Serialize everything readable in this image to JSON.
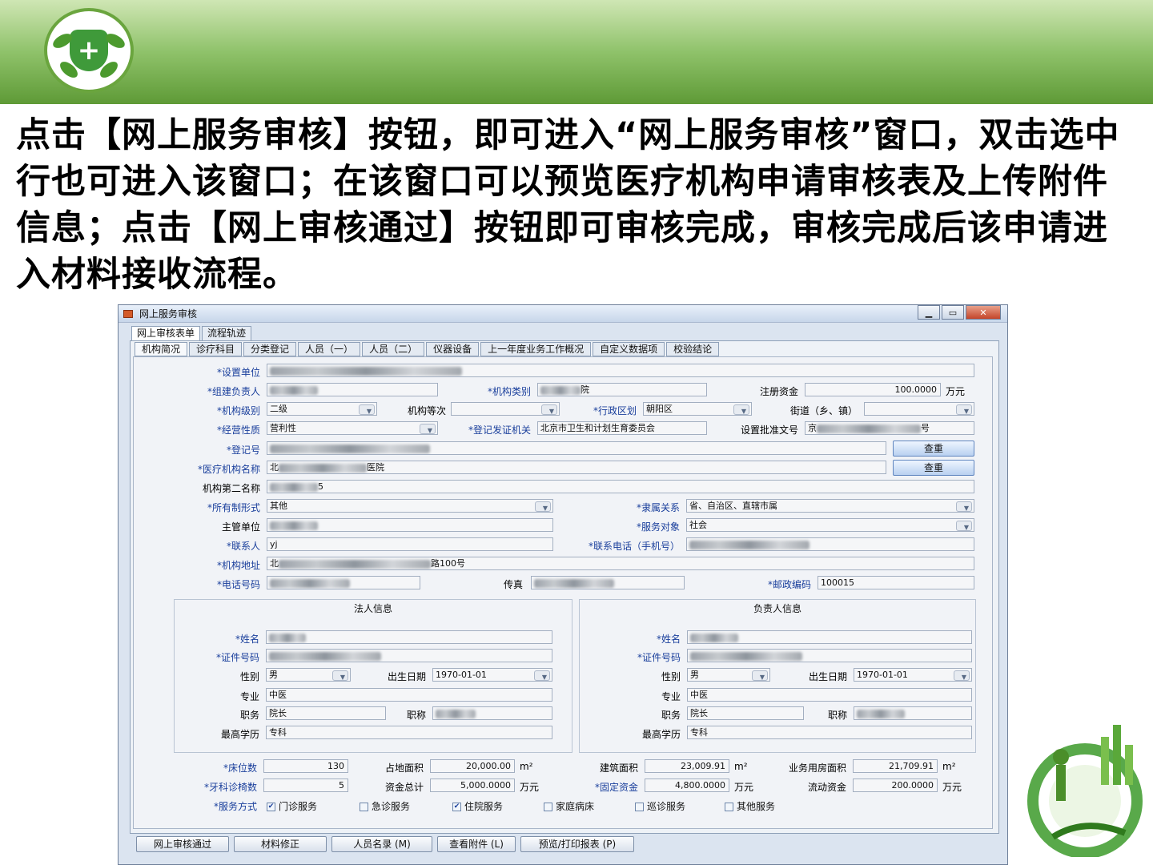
{
  "slide": {
    "intro": "点击【网上服务审核】按钮，即可进入“网上服务审核”窗口，双击选中行也可进入该窗口；在该窗口可以预览医疗机构申请审核表及上传附件信息；点击【网上审核通过】按钮即可审核完成，审核完成后该申请进入材料接收流程。"
  },
  "window": {
    "title": "网上服务审核",
    "outer_tabs": [
      "网上审核表单",
      "流程轨迹"
    ],
    "inner_tabs": [
      "机构简况",
      "诊疗科目",
      "分类登记",
      "人员（一）",
      "人员（二）",
      "仪器设备",
      "上一年度业务工作概况",
      "自定义数据项",
      "校验结论"
    ]
  },
  "form": {
    "labels": {
      "set_unit": "*设置单位",
      "leader": "*组建负责人",
      "inst_type": "*机构类别",
      "reg_capital": "注册资金",
      "capital_unit": "万元",
      "inst_level": "*机构级别",
      "inst_grade": "机构等次",
      "district": "*行政区划",
      "street": "街道（乡、镇）",
      "nature": "*经营性质",
      "reg_authority": "*登记发证机关",
      "approval_no": "设置批准文号",
      "reg_no": "*登记号",
      "inst_name": "*医疗机构名称",
      "second_name": "机构第二名称",
      "ownership": "*所有制形式",
      "affiliation": "*隶属关系",
      "supervisor": "主管单位",
      "service_obj": "*服务对象",
      "contact": "*联系人",
      "mobile": "*联系电话（手机号）",
      "address": "*机构地址",
      "phone": "*电话号码",
      "fax": "传真",
      "postcode": "*邮政编码"
    },
    "values": {
      "inst_type_suffix": "院",
      "reg_capital": "100.0000",
      "inst_level": "二级",
      "district": "朝阳区",
      "nature": "营利性",
      "reg_authority": "北京市卫生和计划生育委员会",
      "approval_no_prefix": "京",
      "approval_no_suffix": "号",
      "inst_name_prefix": "北",
      "inst_name_suffix": "医院",
      "second_name_suffix": "5",
      "ownership": "其他",
      "affiliation": "省、自治区、直辖市属",
      "service_obj": "社会",
      "contact": "yj",
      "address_prefix": "北",
      "address_suffix": "路100号",
      "postcode": "100015"
    },
    "check_button": "查重",
    "check_button2": "查重"
  },
  "legal_person": {
    "title": "法人信息",
    "labels": {
      "name": "*姓名",
      "id": "*证件号码",
      "gender": "性别",
      "birth": "出生日期",
      "major": "专业",
      "post": "职务",
      "title": "职称",
      "edu": "最高学历"
    },
    "values": {
      "gender": "男",
      "birth": "1970-01-01",
      "major": "中医",
      "post": "院长",
      "edu": "专科"
    }
  },
  "head_person": {
    "title": "负责人信息",
    "labels": {
      "name": "*姓名",
      "id": "*证件号码",
      "gender": "性别",
      "birth": "出生日期",
      "major": "专业",
      "post": "职务",
      "title": "职称",
      "edu": "最高学历"
    },
    "values": {
      "gender": "男",
      "birth": "1970-01-01",
      "major": "中医",
      "post": "院长",
      "edu": "专科"
    }
  },
  "stats": {
    "labels": {
      "beds": "*床位数",
      "land": "占地面积",
      "building": "建筑面积",
      "business_area": "业务用房面积",
      "dental": "*牙科诊椅数",
      "total_fund": "资金总计",
      "fixed_fund": "*固定资金",
      "liquid_fund": "流动资金",
      "service_mode": "*服务方式"
    },
    "values": {
      "beds": "130",
      "land": "20,000.00",
      "building": "23,009.91",
      "business_area": "21,709.91",
      "dental": "5",
      "total_fund": "5,000.0000",
      "fixed_fund": "4,800.0000",
      "liquid_fund": "200.0000"
    },
    "units": {
      "area": "m²",
      "money": "万元"
    },
    "services": [
      {
        "label": "门诊服务",
        "checked": true
      },
      {
        "label": "急诊服务",
        "checked": false
      },
      {
        "label": "住院服务",
        "checked": true
      },
      {
        "label": "家庭病床",
        "checked": false
      },
      {
        "label": "巡诊服务",
        "checked": false
      },
      {
        "label": "其他服务",
        "checked": false
      }
    ]
  },
  "buttons": [
    "网上审核通过",
    "材料修正",
    "人员名录 (M)",
    "查看附件 (L)",
    "预览/打印报表 (P)"
  ]
}
